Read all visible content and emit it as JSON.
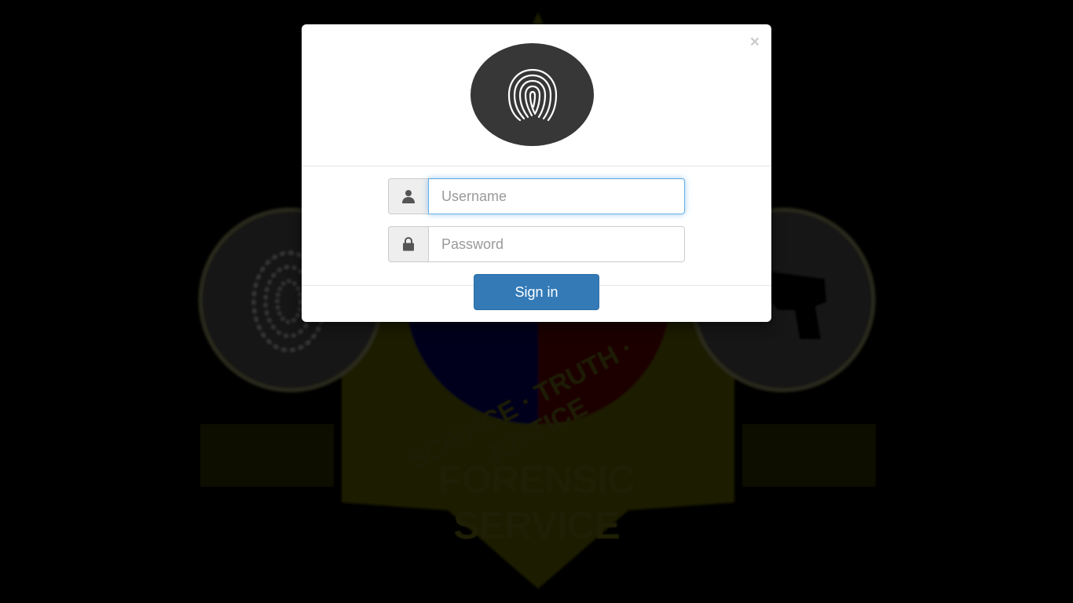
{
  "background": {
    "banner_text": "FORENSIC SERVICE",
    "motto": "SCIENCE · TRUTH · JUSTICE"
  },
  "modal": {
    "close_label": "×",
    "logo_icon": "fingerprint-icon",
    "username": {
      "placeholder": "Username",
      "value": "",
      "icon": "user-icon"
    },
    "password": {
      "placeholder": "Password",
      "value": "",
      "icon": "lock-icon"
    },
    "signin_label": "Sign in"
  },
  "colors": {
    "primary": "#337ab7",
    "logo_bg": "#373737",
    "focus": "#66afe9"
  }
}
